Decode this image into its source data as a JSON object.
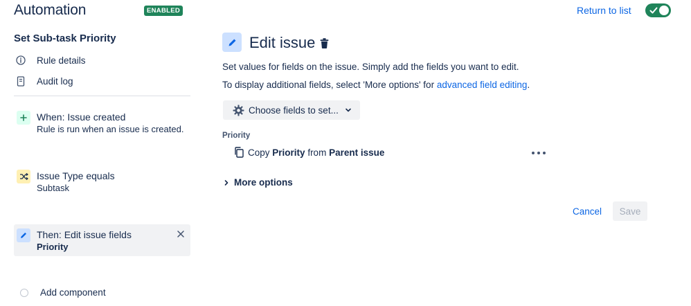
{
  "header": {
    "title": "Automation",
    "status_badge": "ENABLED",
    "return_link": "Return to list",
    "toggle_on": true
  },
  "sidebar": {
    "rule_name": "Set Sub-task Priority",
    "links": [
      {
        "label": "Rule details",
        "icon": "info-icon"
      },
      {
        "label": "Audit log",
        "icon": "document-icon"
      }
    ],
    "components": [
      {
        "title": "When: Issue created",
        "subtitle": "Rule is run when an issue is created.",
        "icon": "plus-icon",
        "color": "#dcfff1"
      },
      {
        "title": "Issue Type equals",
        "subtitle": "Subtask",
        "icon": "shuffle-icon",
        "color": "#fff7d6"
      },
      {
        "title": "Then: Edit issue fields",
        "subtitle": "Priority",
        "icon": "pencil-icon",
        "color": "#cce0ff",
        "selected": true
      }
    ],
    "add_component": "Add component"
  },
  "main": {
    "title": "Edit issue",
    "description_1": "Set values for fields on the issue. Simply add the fields you want to edit.",
    "description_2_prefix": "To display additional fields, select 'More options' for ",
    "description_2_link": "advanced field editing",
    "description_2_suffix": ".",
    "choose_fields_label": "Choose fields to set...",
    "field_label": "Priority",
    "copy_row": {
      "prefix": "Copy",
      "field": "Priority",
      "middle": "from",
      "source": "Parent issue"
    },
    "more_options": "More options",
    "cancel_label": "Cancel",
    "save_label": "Save"
  },
  "colors": {
    "accent": "#0c66e4",
    "enabled_green": "#1f845a",
    "text": "#172b4d"
  }
}
